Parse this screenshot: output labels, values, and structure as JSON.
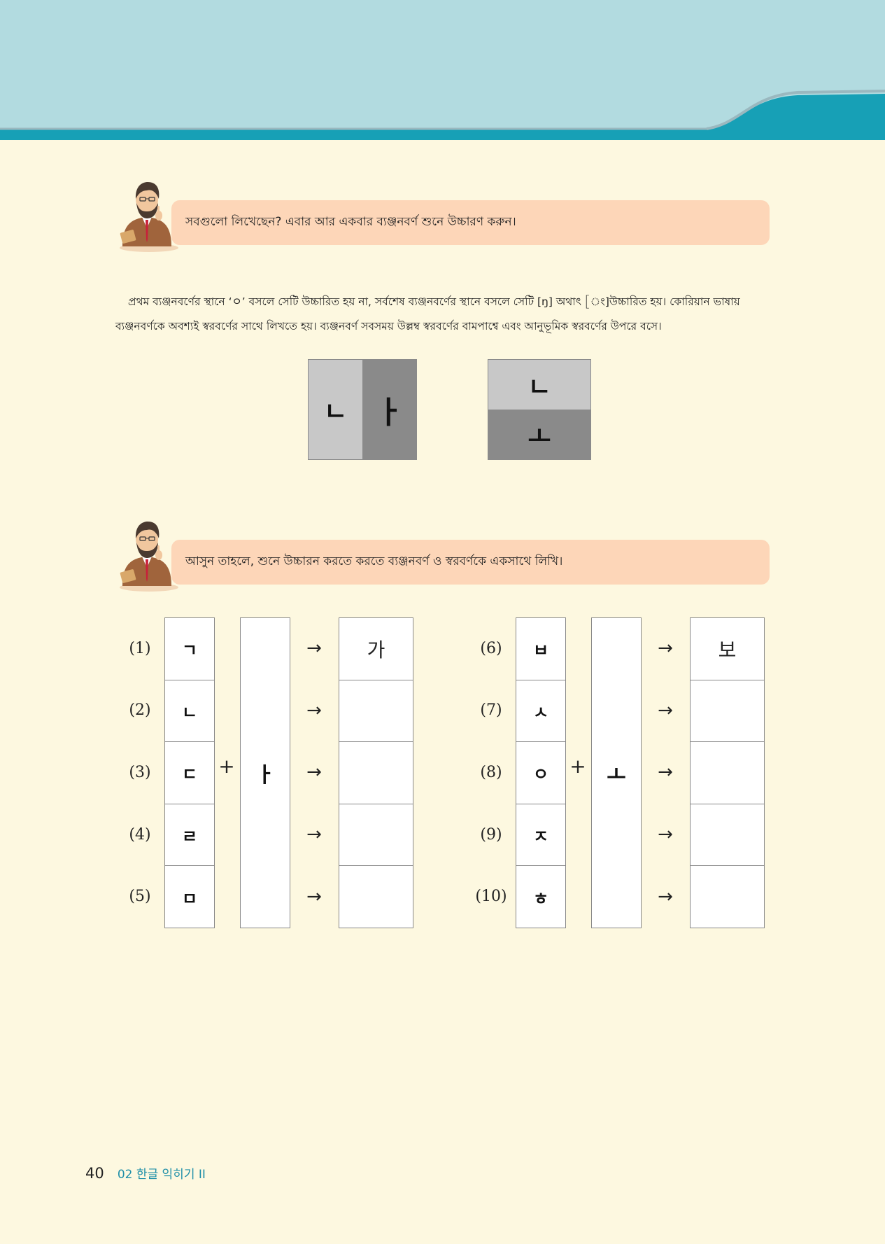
{
  "colors": {
    "background": "#fdf8e0",
    "header_sky": "#b2dbe0",
    "header_teal": "#17a0b6",
    "bubble": "#fdd6b8"
  },
  "dialog1": {
    "text": "সবগুলো লিখেছেন? এবার আর একবার ব্যঞ্জনবর্ণ শুনে উচ্চারণ করুন।",
    "icon": "teacher-icon"
  },
  "intro": {
    "line1": "প্রথম ব্যঞ্জনবর্ণের স্থানে ‘ㅇ’ বসলে সেটি উচ্চারিত হয় না, সর্বশেষ ব্যঞ্জনবর্ণের স্থানে বসলে সেটি [ŋ] অথাৎ [ং]উচ্চারিত হয়। কোরিয়ান ভাষায়",
    "line2": "ব্যঞ্জনবর্ণকে অবশ্যই স্বরবর্ণের সাথে লিখতে হয়। ব্যঞ্জনবর্ণ সবসময় উল্লম্ব স্বরবর্ণের বামপাশ্বে এবং আনুভূমিক স্বরবর্ণের উপরে বসে।"
  },
  "diagram_vertical": {
    "consonant": "ㄴ",
    "vowel": "ㅏ"
  },
  "diagram_horizontal": {
    "consonant": "ㄴ",
    "vowel": "ㅗ"
  },
  "dialog2": {
    "text": "আসুন তাহলে, শুনে উচ্চারন করতে করতে ব্যঞ্জনবর্ণ ও স্বরবর্ণকে একসাথে লিখি।",
    "icon": "teacher-icon"
  },
  "exercise1": {
    "numbers": [
      "(1)",
      "(2)",
      "(3)",
      "(4)",
      "(5)"
    ],
    "consonants": [
      "ㄱ",
      "ㄴ",
      "ㄷ",
      "ㄹ",
      "ㅁ"
    ],
    "plus": "+",
    "vowel": "ㅏ",
    "arrow": "→",
    "results": [
      "가",
      "",
      "",
      "",
      ""
    ]
  },
  "exercise2": {
    "numbers": [
      "(6)",
      "(7)",
      "(8)",
      "(9)",
      "(10)"
    ],
    "consonants": [
      "ㅂ",
      "ㅅ",
      "ㅇ",
      "ㅈ",
      "ㅎ"
    ],
    "plus": "+",
    "vowel": "ㅗ",
    "arrow": "→",
    "results": [
      "보",
      "",
      "",
      "",
      ""
    ]
  },
  "footer": {
    "page_number": "40",
    "chapter": "02 한글 익히기 II"
  }
}
